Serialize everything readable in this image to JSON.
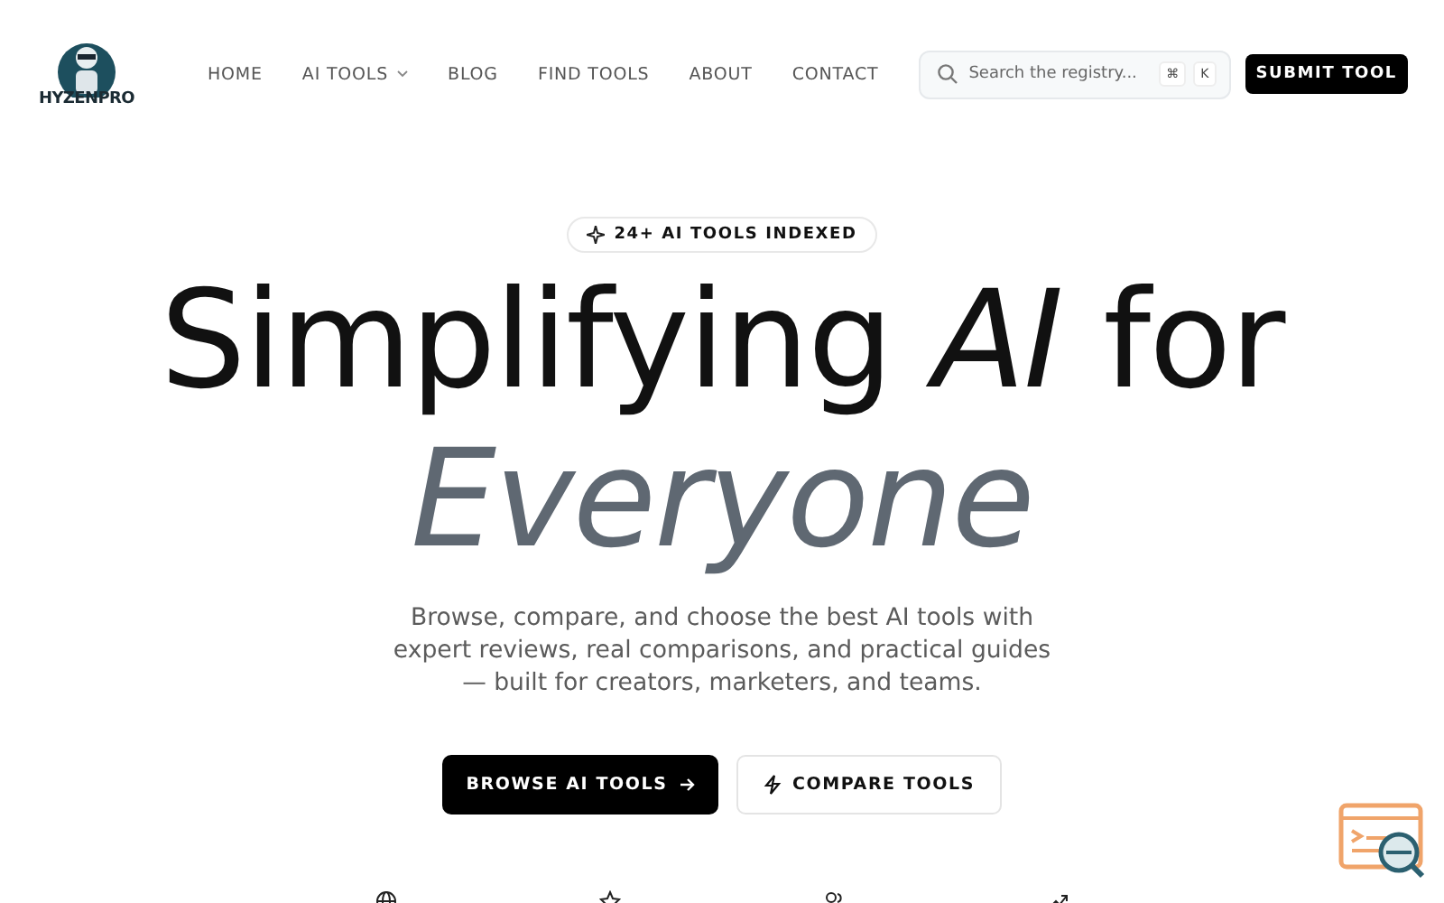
{
  "logo": {
    "text": "HYZENPRO"
  },
  "nav": [
    {
      "label": "HOME",
      "dropdown": false
    },
    {
      "label": "AI TOOLS",
      "dropdown": true
    },
    {
      "label": "BLOG",
      "dropdown": false
    },
    {
      "label": "FIND TOOLS",
      "dropdown": false
    },
    {
      "label": "ABOUT",
      "dropdown": false
    },
    {
      "label": "CONTACT",
      "dropdown": false
    }
  ],
  "search": {
    "placeholder": "Search the registry...",
    "keys": [
      "⌘",
      "K"
    ]
  },
  "submit_button": "SUBMIT TOOL",
  "hero": {
    "badge": "24+ AI TOOLS INDEXED",
    "title_line_1": "Simplifying *AI* for",
    "title_line_2": "Everyone",
    "subtitle": "Browse, compare, and choose the best AI tools with expert reviews, real comparisons, and practical guides — built for creators, marketers, and teams.",
    "buttons": [
      {
        "label": "BROWSE AI TOOLS",
        "kind": "primary"
      },
      {
        "label": "COMPARE TOOLS",
        "kind": "secondary"
      }
    ]
  },
  "features": [
    {
      "kind": "globe"
    },
    {
      "kind": "star"
    },
    {
      "kind": "users"
    },
    {
      "kind": "trend"
    }
  ]
}
